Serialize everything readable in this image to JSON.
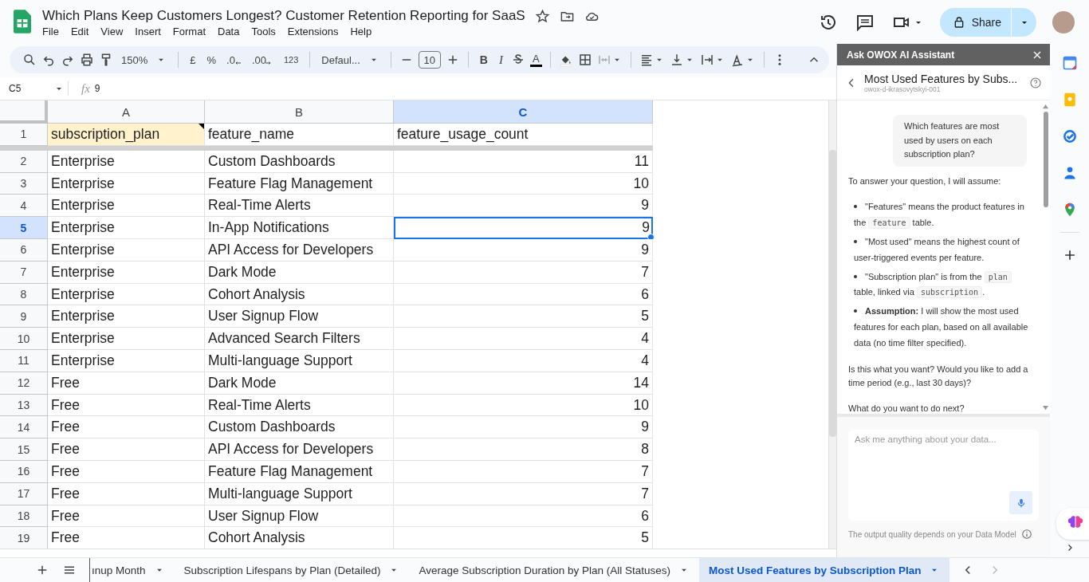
{
  "document": {
    "title": "Which Plans Keep Customers Longest? Customer Retention Reporting for SaaS",
    "menu": [
      "File",
      "Edit",
      "View",
      "Insert",
      "Format",
      "Data",
      "Tools",
      "Extensions",
      "Help"
    ],
    "share_label": "Share"
  },
  "toolbar": {
    "zoom": "150%",
    "currency": "£",
    "percent": "%",
    "decrease_decimals": ".0",
    "increase_decimals": ".00",
    "number_format": "123",
    "font": "Defaul...",
    "font_size": "10",
    "bold": "B",
    "italic": "I",
    "text_color": "A"
  },
  "formula_bar": {
    "cell_ref": "C5",
    "fx": "fx",
    "value": "9"
  },
  "sheet": {
    "columns": [
      {
        "label": "A",
        "kind": "text",
        "selected": false
      },
      {
        "label": "B",
        "kind": "text",
        "selected": false
      },
      {
        "label": "C",
        "kind": "number",
        "selected": true
      }
    ],
    "rows": [
      {
        "number": "1",
        "selected": false,
        "frozen": true,
        "first_cell_note": true,
        "cells": [
          "subscription_plan",
          "feature_name",
          "feature_usage_count"
        ]
      },
      {
        "number": "2",
        "selected": false,
        "cells": [
          "Enterprise",
          "Custom Dashboards",
          "11"
        ]
      },
      {
        "number": "3",
        "selected": false,
        "cells": [
          "Enterprise",
          "Feature Flag Management",
          "10"
        ]
      },
      {
        "number": "4",
        "selected": false,
        "cells": [
          "Enterprise",
          "Real-Time Alerts",
          "9"
        ]
      },
      {
        "number": "5",
        "selected": true,
        "cells": [
          "Enterprise",
          "In-App Notifications",
          "9"
        ]
      },
      {
        "number": "6",
        "selected": false,
        "cells": [
          "Enterprise",
          "API Access for Developers",
          "9"
        ]
      },
      {
        "number": "7",
        "selected": false,
        "cells": [
          "Enterprise",
          "Dark Mode",
          "7"
        ]
      },
      {
        "number": "8",
        "selected": false,
        "cells": [
          "Enterprise",
          "Cohort Analysis",
          "6"
        ]
      },
      {
        "number": "9",
        "selected": false,
        "cells": [
          "Enterprise",
          "User Signup Flow",
          "5"
        ]
      },
      {
        "number": "10",
        "selected": false,
        "cells": [
          "Enterprise",
          "Advanced Search Filters",
          "4"
        ]
      },
      {
        "number": "11",
        "selected": false,
        "cells": [
          "Enterprise",
          "Multi-language Support",
          "4"
        ]
      },
      {
        "number": "12",
        "selected": false,
        "cells": [
          "Free",
          "Dark Mode",
          "14"
        ]
      },
      {
        "number": "13",
        "selected": false,
        "cells": [
          "Free",
          "Real-Time Alerts",
          "10"
        ]
      },
      {
        "number": "14",
        "selected": false,
        "cells": [
          "Free",
          "Custom Dashboards",
          "9"
        ]
      },
      {
        "number": "15",
        "selected": false,
        "cells": [
          "Free",
          "API Access for Developers",
          "8"
        ]
      },
      {
        "number": "16",
        "selected": false,
        "cells": [
          "Free",
          "Feature Flag Management",
          "7"
        ]
      },
      {
        "number": "17",
        "selected": false,
        "cells": [
          "Free",
          "Multi-language Support",
          "7"
        ]
      },
      {
        "number": "18",
        "selected": false,
        "cells": [
          "Free",
          "User Signup Flow",
          "6"
        ]
      },
      {
        "number": "19",
        "selected": false,
        "cells": [
          "Free",
          "Cohort Analysis",
          "5"
        ]
      }
    ]
  },
  "sheet_tabs": [
    {
      "label": "ınup Month",
      "selected": false
    },
    {
      "label": "Subscription Lifespans by Plan (Detailed)",
      "selected": false
    },
    {
      "label": "Average Subscription Duration by Plan (All Statuses)",
      "selected": false
    },
    {
      "label": "Most Used Features by Subscription Plan",
      "selected": true
    }
  ],
  "assistant": {
    "title": "Ask OWOX AI Assistant",
    "chat_title": "Most Used Features by Subs...",
    "project": "owox-d-ikrasovytskyi-001",
    "user_message": "Which features are most used by users on each subscription plan?",
    "intro": "To answer your question, I will assume:",
    "bullets": [
      [
        {
          "kind": "text",
          "text": "\"Features\" means the product features in the "
        },
        {
          "kind": "code",
          "text": "feature"
        },
        {
          "kind": "text",
          "text": " table."
        }
      ],
      [
        {
          "kind": "text",
          "text": "\"Most used\" means the highest count of user-triggered events per feature."
        }
      ],
      [
        {
          "kind": "text",
          "text": "\"Subscription plan\" is from the "
        },
        {
          "kind": "code",
          "text": "plan"
        },
        {
          "kind": "text",
          "text": " table, linked via "
        },
        {
          "kind": "code",
          "text": "subscription"
        },
        {
          "kind": "text",
          "text": "."
        }
      ],
      [
        {
          "kind": "bold",
          "text": "Assumption:"
        },
        {
          "kind": "text",
          "text": " I will show the most used features for each plan, based on all available data (no time filter specified)."
        }
      ]
    ],
    "follow_ups": [
      "Is this what you want? Would you like to add a time period (e.g., last 30 days)?",
      "What do you want to do next?"
    ],
    "input_placeholder": "Ask me anything about your data...",
    "footer": "The output quality depends on your Data Model"
  }
}
